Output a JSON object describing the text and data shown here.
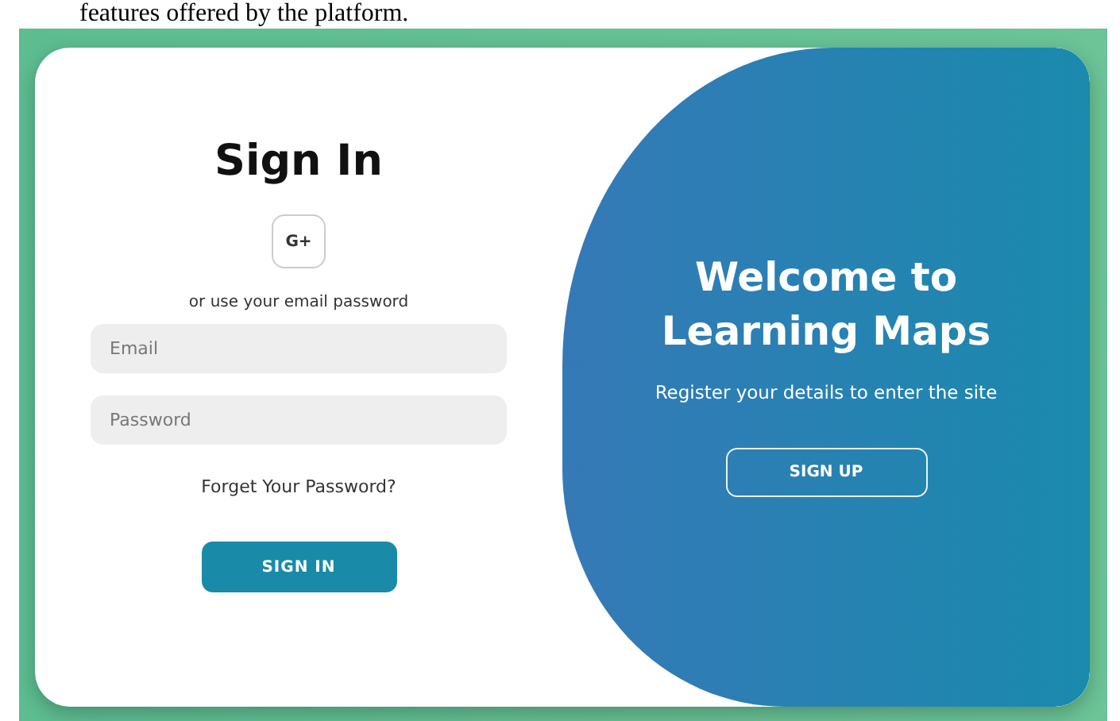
{
  "document_text": "features offered by the platform.",
  "sign_in": {
    "title": "Sign In",
    "social_button": "G+",
    "divider_text": "or use your email password",
    "fields": [
      {
        "placeholder": "Email"
      },
      {
        "placeholder": "Password"
      }
    ],
    "forgot_link": "Forget Your Password?",
    "button": "SIGN IN"
  },
  "welcome": {
    "title": "Welcome to Learning Maps",
    "subtitle": "Register your details to enter the site",
    "button": "SIGN UP"
  }
}
